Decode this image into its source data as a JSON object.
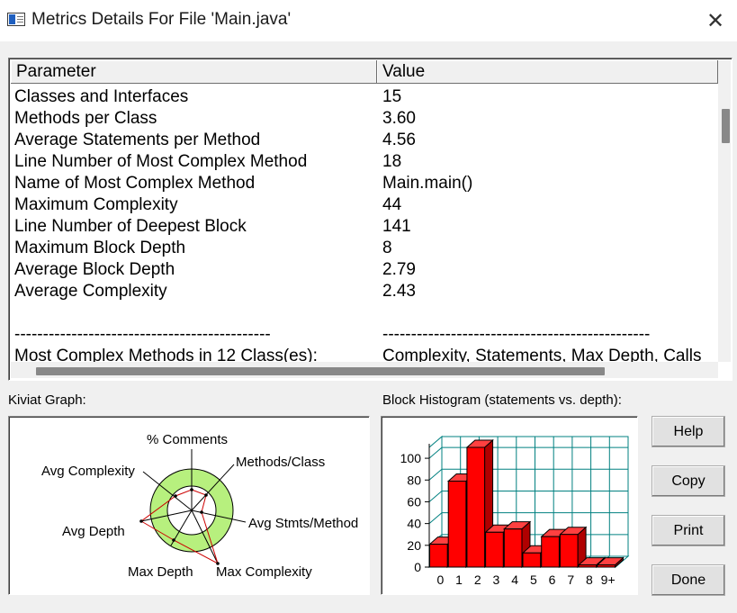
{
  "window": {
    "title": "Metrics Details For File 'Main.java'"
  },
  "table": {
    "columns": [
      "Parameter",
      "Value"
    ],
    "rows": [
      [
        "Classes and Interfaces",
        "15"
      ],
      [
        "Methods per Class",
        "3.60"
      ],
      [
        "Average Statements per Method",
        "4.56"
      ],
      [
        "Line Number of Most Complex Method",
        "18"
      ],
      [
        "Name of Most Complex Method",
        "Main.main()"
      ],
      [
        "Maximum Complexity",
        "44"
      ],
      [
        "Line Number of Deepest Block",
        "141"
      ],
      [
        "Maximum Block Depth",
        "8"
      ],
      [
        "Average Block Depth",
        "2.79"
      ],
      [
        "Average Complexity",
        "2.43"
      ],
      [
        "",
        ""
      ],
      [
        "---------------------------------------------",
        "-----------------------------------------------"
      ],
      [
        "Most Complex Methods in 12 Class(es):",
        "Complexity, Statements, Max Depth, Calls"
      ]
    ]
  },
  "kiviat": {
    "label": "Kiviat Graph:",
    "axes": {
      "comments": "% Comments",
      "methods": "Methods/Class",
      "stmts": "Avg Stmts/Method",
      "max_complexity": "Max Complexity",
      "max_depth": "Max Depth",
      "avg_depth": "Avg Depth",
      "avg_complexity": "Avg Complexity"
    }
  },
  "histogram": {
    "label": "Block Histogram (statements vs. depth):",
    "chart_data": {
      "type": "bar",
      "categories": [
        "0",
        "1",
        "2",
        "3",
        "4",
        "5",
        "6",
        "7",
        "8",
        "9+"
      ],
      "values": [
        21,
        79,
        110,
        32,
        35,
        13,
        28,
        30,
        2,
        2
      ],
      "ylim": [
        0,
        110
      ],
      "yticks": [
        "0",
        "20",
        "40",
        "60",
        "80",
        "100"
      ],
      "grid": true,
      "bar_color": "#ff0000",
      "grid_color": "#008080"
    }
  },
  "buttons": {
    "help": "Help",
    "copy": "Copy",
    "print": "Print",
    "done": "Done"
  }
}
